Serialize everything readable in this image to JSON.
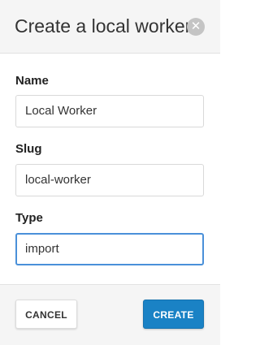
{
  "dialog": {
    "title": "Create a local worker",
    "close_icon": "close-icon"
  },
  "fields": {
    "name": {
      "label": "Name",
      "value": "Local Worker"
    },
    "slug": {
      "label": "Slug",
      "value": "local-worker"
    },
    "type": {
      "label": "Type",
      "value": "import"
    }
  },
  "footer": {
    "cancel_label": "CANCEL",
    "create_label": "CREATE"
  },
  "colors": {
    "primary": "#1a82c5",
    "focus_border": "#4a90d9",
    "header_bg": "#f5f5f5"
  }
}
